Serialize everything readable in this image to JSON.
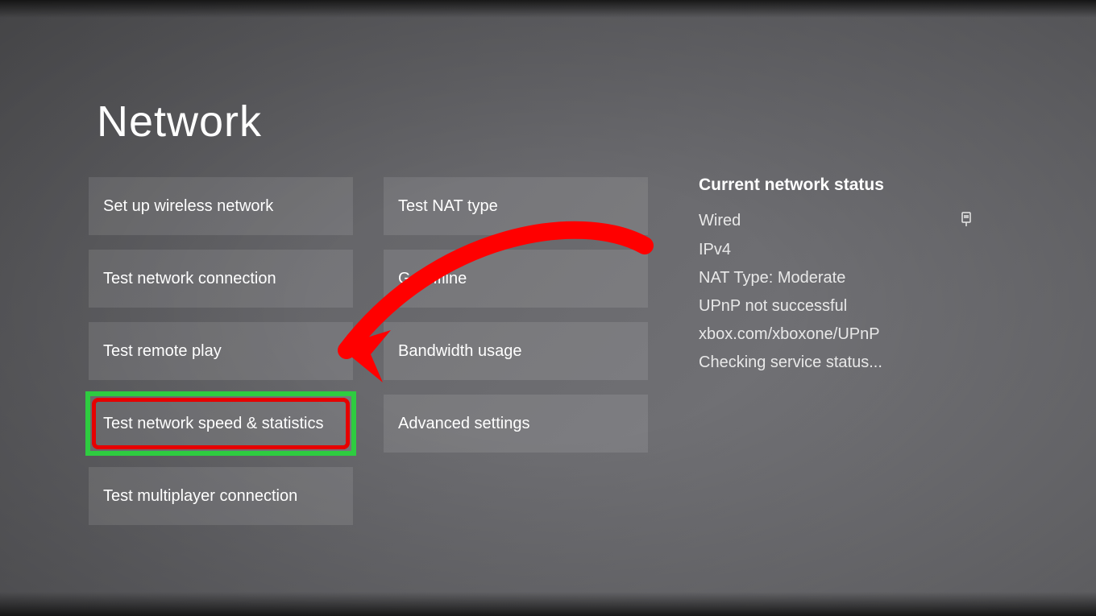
{
  "title": "Network",
  "columns": {
    "left": [
      {
        "id": "setup-wireless",
        "label": "Set up wireless network"
      },
      {
        "id": "test-connection",
        "label": "Test network connection"
      },
      {
        "id": "test-remote-play",
        "label": "Test remote play"
      },
      {
        "id": "test-speed",
        "label": "Test network speed & statistics",
        "highlighted": true
      },
      {
        "id": "test-multiplayer",
        "label": "Test multiplayer connection"
      }
    ],
    "right": [
      {
        "id": "test-nat",
        "label": "Test NAT type"
      },
      {
        "id": "go-offline",
        "label": "Go offline"
      },
      {
        "id": "bandwidth",
        "label": "Bandwidth usage"
      },
      {
        "id": "advanced",
        "label": "Advanced settings"
      }
    ]
  },
  "status": {
    "header": "Current network status",
    "items": [
      {
        "label": "Wired",
        "icon": "ethernet"
      },
      {
        "label": "IPv4"
      },
      {
        "label": "NAT Type: Moderate"
      },
      {
        "label": "UPnP not successful"
      },
      {
        "label": "xbox.com/xboxone/UPnP"
      },
      {
        "label": "Checking service status..."
      }
    ]
  },
  "annotation": {
    "arrow_color": "#ff0000",
    "highlight_outer": "#2ecc40",
    "highlight_inner": "#e60000"
  }
}
